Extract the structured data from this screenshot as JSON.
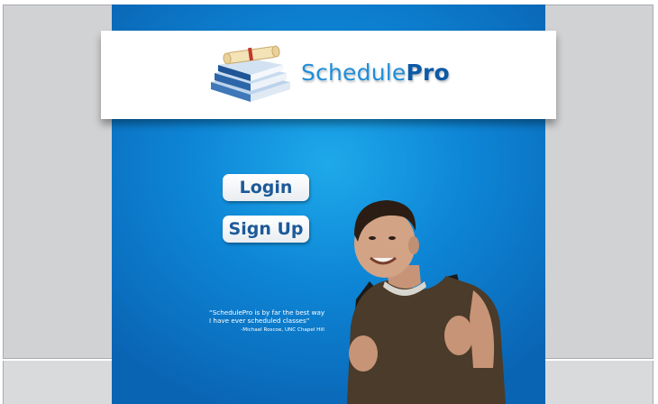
{
  "header": {
    "brand_part1": "Schedule",
    "brand_part2": "Pro",
    "logo_icon": "books-diploma-icon"
  },
  "actions": {
    "login_label": "Login",
    "signup_label": "Sign Up"
  },
  "testimonial": {
    "quote": "“SchedulePro is by far the best way I have ever scheduled classes”",
    "attribution": "-Michael Roscoe, UNC Chapel Hill"
  },
  "colors": {
    "stage_center": "#1ea9ea",
    "stage_edge": "#0a64b4",
    "brand_light": "#1f8ed8",
    "brand_dark": "#0d5aa6",
    "button_text": "#1c5a98"
  }
}
